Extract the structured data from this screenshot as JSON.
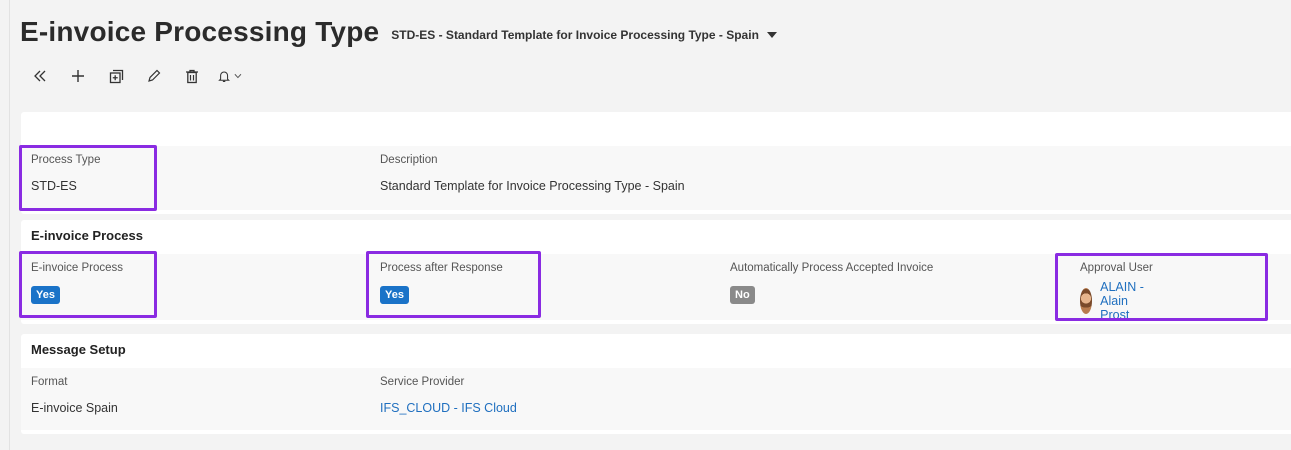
{
  "header": {
    "title": "E-invoice Processing Type",
    "record": "STD-ES - Standard Template for Invoice Processing Type - Spain"
  },
  "toolbar": {
    "items": [
      "collapse-icon",
      "add-icon",
      "duplicate-icon",
      "edit-icon",
      "delete-icon",
      "bell-icon"
    ]
  },
  "main": {
    "process_type_label": "Process Type",
    "process_type_value": "STD-ES",
    "description_label": "Description",
    "description_value": "Standard Template for Invoice Processing Type - Spain"
  },
  "einvoice": {
    "section_title": "E-invoice Process",
    "process_label": "E-invoice Process",
    "process_value": "Yes",
    "after_response_label": "Process after Response",
    "after_response_value": "Yes",
    "auto_accept_label": "Automatically Process Accepted Invoice",
    "auto_accept_value": "No",
    "approval_user_label": "Approval User",
    "approval_user_value": "ALAIN - Alain Prost"
  },
  "message": {
    "section_title": "Message Setup",
    "format_label": "Format",
    "format_value": "E-invoice Spain",
    "provider_label": "Service Provider",
    "provider_value": "IFS_CLOUD - IFS Cloud"
  },
  "colors": {
    "highlight": "#8a2be2",
    "yes_badge": "#1a73c8",
    "no_badge": "#8a8a8a",
    "link": "#1f6fbf"
  }
}
